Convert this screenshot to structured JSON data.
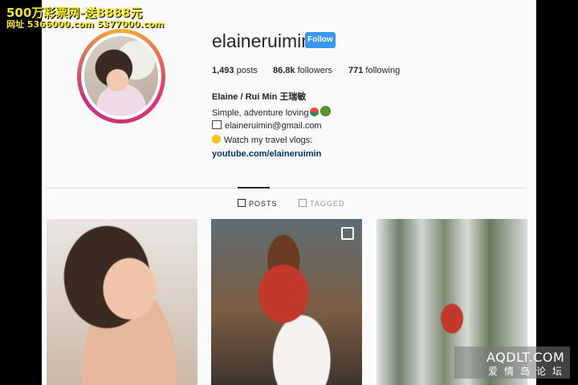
{
  "overlay": {
    "line1": "500万彩票网-送8888元",
    "line2": "网址 5366000.com 5377000.com"
  },
  "watermark": {
    "line1": "AQDLT.COM",
    "line2": "爱情岛论坛"
  },
  "profile": {
    "username": "elaineruimin",
    "follow_label": "Follow",
    "posts_count": "1,493",
    "posts_label": "posts",
    "followers_count": "86.8k",
    "followers_label": "followers",
    "following_count": "771",
    "following_label": "following",
    "bio_name": "Elaine / Rui Min 王瑞敏",
    "bio_line2": "Simple, adventure loving",
    "bio_email": "elaineruimin@gmail.com",
    "bio_line4": "Watch my travel vlogs:",
    "bio_link": "youtube.com/elaineruimin"
  },
  "tabs": {
    "posts": "POSTS",
    "tagged": "TAGGED"
  },
  "colors": {
    "follow_button": "#3897f0",
    "link": "#003569"
  }
}
